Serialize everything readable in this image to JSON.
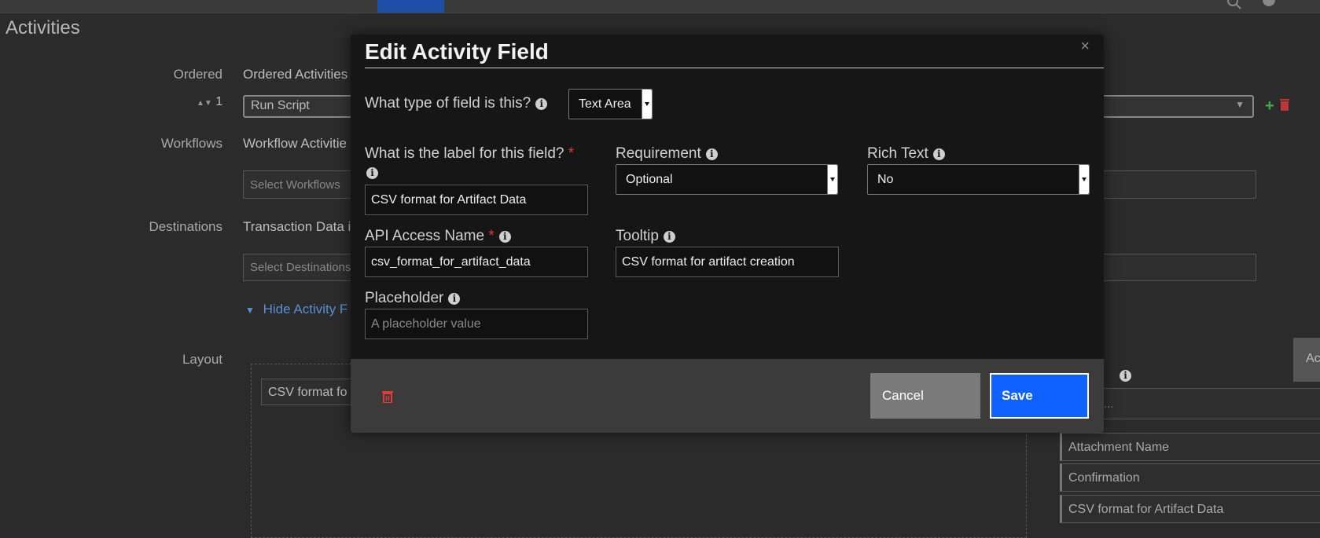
{
  "page": {
    "title": "Activities",
    "labels": {
      "ordered": "Ordered",
      "order_num": "1",
      "workflows": "Workflows",
      "destinations": "Destinations",
      "layout": "Layout"
    },
    "ordered_activities": "Ordered Activities",
    "run_script": "Run Script",
    "workflow_activities": "Workflow Activitie",
    "select_workflows": "Select Workflows",
    "transaction_data": "Transaction Data i",
    "select_destinations": "Select Destinations",
    "hide_activity": "Hide Activity F",
    "layout_field": "CSV format fo",
    "add_button": "Ac",
    "right_partial": "...",
    "right_list": [
      "Attachment Name",
      "Confirmation",
      "CSV format for Artifact Data"
    ]
  },
  "modal": {
    "title": "Edit Activity Field",
    "field_type_label": "What type of field is this?",
    "field_type_value": "Text Area",
    "label_question": "What is the label for this field?",
    "label_value": "CSV format for Artifact Data",
    "requirement_label": "Requirement",
    "requirement_value": "Optional",
    "rich_text_label": "Rich Text",
    "rich_text_value": "No",
    "api_label": "API Access Name",
    "api_value": "csv_format_for_artifact_data",
    "tooltip_label": "Tooltip",
    "tooltip_value": "CSV format for artifact creation",
    "placeholder_label": "Placeholder",
    "placeholder_placeholder": "A placeholder value",
    "required_mark": "*",
    "cancel": "Cancel",
    "save": "Save"
  },
  "colors": {
    "primary": "#0f62fe",
    "danger": "#e03a3a",
    "add": "#3fae4a",
    "link": "#5b8fd6"
  }
}
